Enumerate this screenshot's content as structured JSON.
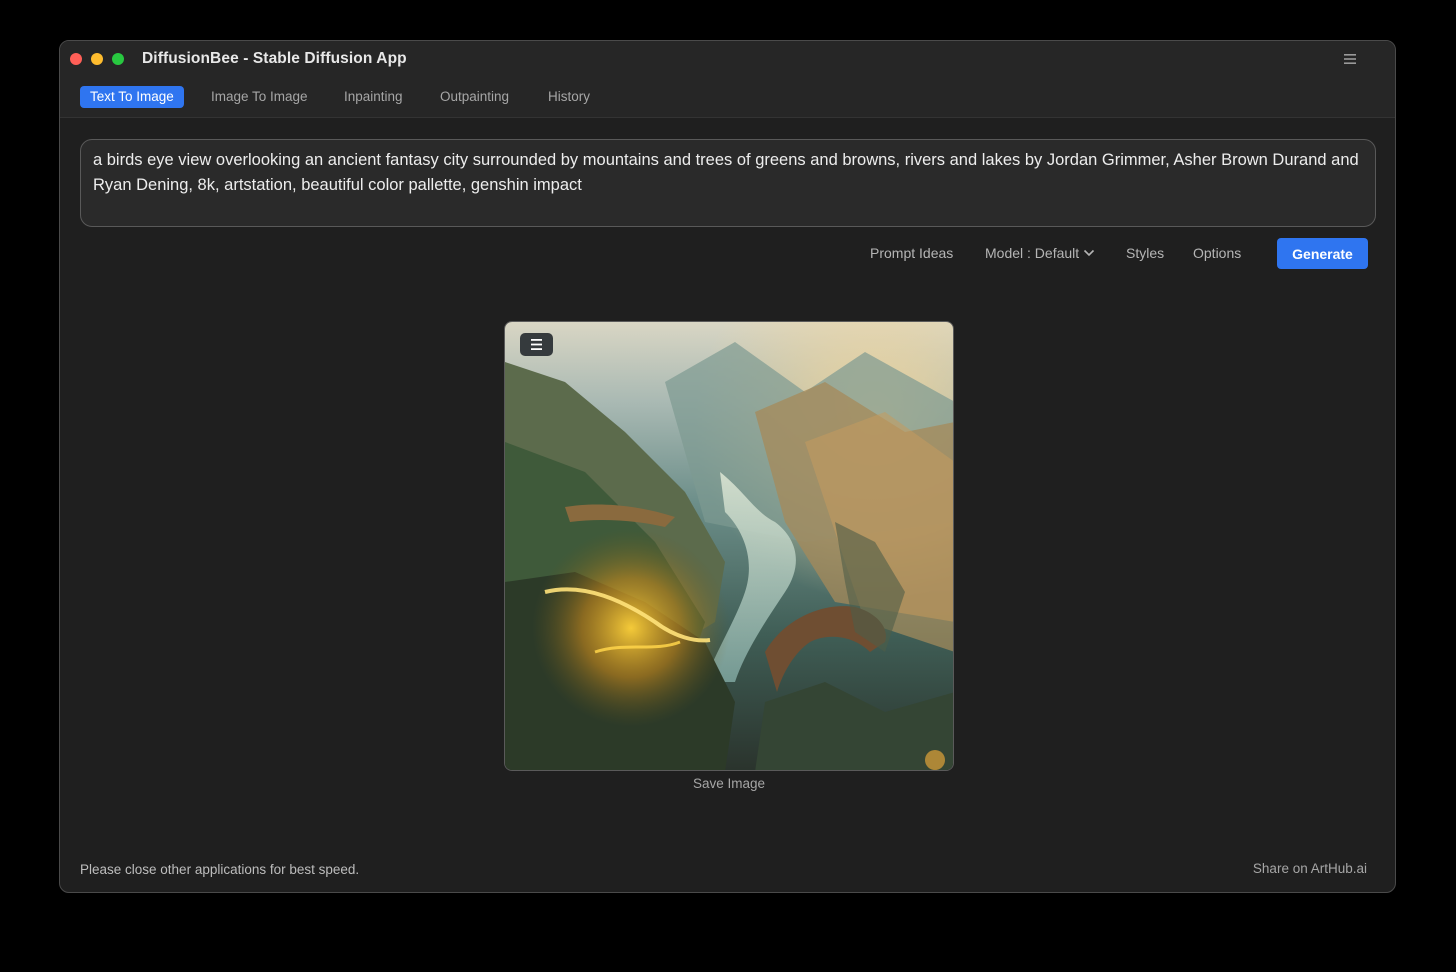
{
  "window": {
    "title": "DiffusionBee - Stable Diffusion App",
    "menu_icon": "hamburger-menu-icon"
  },
  "tabs": [
    {
      "label": "Text To Image",
      "active": true
    },
    {
      "label": "Image To Image",
      "active": false
    },
    {
      "label": "Inpainting",
      "active": false
    },
    {
      "label": "Outpainting",
      "active": false
    },
    {
      "label": "History",
      "active": false
    }
  ],
  "prompt": {
    "value": "a birds eye view overlooking an ancient fantasy city surrounded by mountains and trees of greens and browns, rivers and lakes by Jordan Grimmer, Asher Brown Durand and Ryan Dening, 8k, artstation, beautiful color pallette, genshin impact"
  },
  "toolbar": {
    "prompt_ideas": "Prompt Ideas",
    "model": "Model : Default",
    "styles": "Styles",
    "options": "Options",
    "generate": "Generate"
  },
  "result": {
    "image_icon": "fantasy-landscape-image",
    "menu_icon": "hamburger-menu-icon",
    "save_label": "Save Image"
  },
  "footer": {
    "note": "Please close other applications for best speed.",
    "share": "Share on ArtHub.ai"
  },
  "colors": {
    "accent": "#2f75f0",
    "background": "#1f1f1f",
    "titlebar": "#262626"
  }
}
